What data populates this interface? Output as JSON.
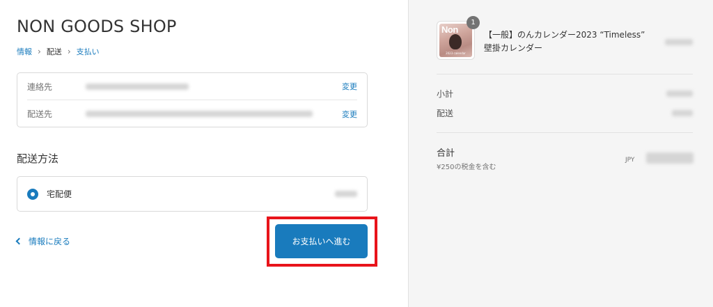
{
  "shop": {
    "title": "NON GOODS SHOP"
  },
  "breadcrumb": {
    "items": [
      {
        "label": "情報",
        "link": true
      },
      {
        "label": "配送",
        "link": false
      },
      {
        "label": "支払い",
        "link": true
      }
    ],
    "separator": "›"
  },
  "review": {
    "contact_label": "連絡先",
    "contact_change": "変更",
    "shipto_label": "配送先",
    "shipto_change": "変更"
  },
  "shipping_method": {
    "title": "配送方法",
    "option_label": "宅配便",
    "selected": true
  },
  "actions": {
    "back_label": "情報に戻る",
    "continue_label": "お支払いへ進む"
  },
  "order_summary": {
    "product": {
      "name": "【一般】のんカレンダー2023 “Timeless” 壁掛カレンダー",
      "quantity": "1",
      "thumb_logo": "Non",
      "thumb_caption": "2023 calendar"
    },
    "subtotal_label": "小計",
    "shipping_label": "配送",
    "total_label": "合計",
    "tax_note": "¥250の税金を含む",
    "currency": "JPY"
  },
  "colors": {
    "accent": "#197bbd",
    "highlight": "#e8141b",
    "sidebar_bg": "#f5f5f5"
  }
}
